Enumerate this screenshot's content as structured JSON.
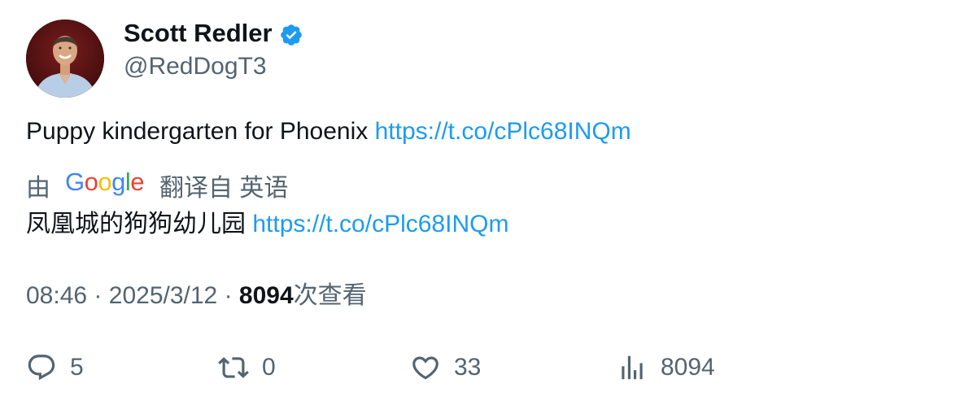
{
  "author": {
    "name": "Scott Redler",
    "handle": "@RedDogT3"
  },
  "tweet": {
    "text": "Puppy kindergarten for Phoenix",
    "link": "https://t.co/cPlc68INQm"
  },
  "translation": {
    "by_label": "由",
    "google_logo_text": "Google",
    "translated_from_label": "翻译自 英语",
    "text": "凤凰城的狗狗幼儿园",
    "link": "https://t.co/cPlc68INQm"
  },
  "meta": {
    "time": "08:46",
    "separator": "·",
    "date": "2025/3/12",
    "views_count": "8094",
    "views_label": "次查看"
  },
  "actions": {
    "reply_count": "5",
    "retweet_count": "0",
    "like_count": "33",
    "views_count": "8094"
  },
  "colors": {
    "link": "#1d9bf0",
    "secondary_text": "#536471",
    "verified": "#1d9bf0"
  }
}
